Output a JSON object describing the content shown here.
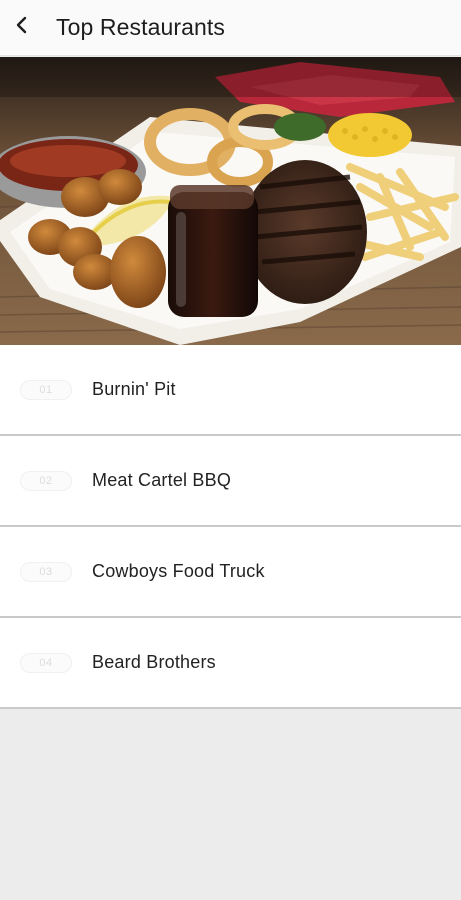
{
  "header": {
    "back_icon": "chevron-left-icon",
    "title": "Top Restaurants"
  },
  "hero": {
    "image": "food-platter-steak-fries-photo"
  },
  "restaurants": [
    {
      "rank": "01",
      "name": "Burnin' Pit"
    },
    {
      "rank": "02",
      "name": "Meat Cartel BBQ"
    },
    {
      "rank": "03",
      "name": "Cowboys Food Truck"
    },
    {
      "rank": "04",
      "name": "Beard Brothers"
    }
  ],
  "colors": {
    "header_bg": "#fafafa",
    "page_bg": "#ececec",
    "row_bg": "#ffffff",
    "divider": "#c9c9c9",
    "text": "#222222"
  }
}
